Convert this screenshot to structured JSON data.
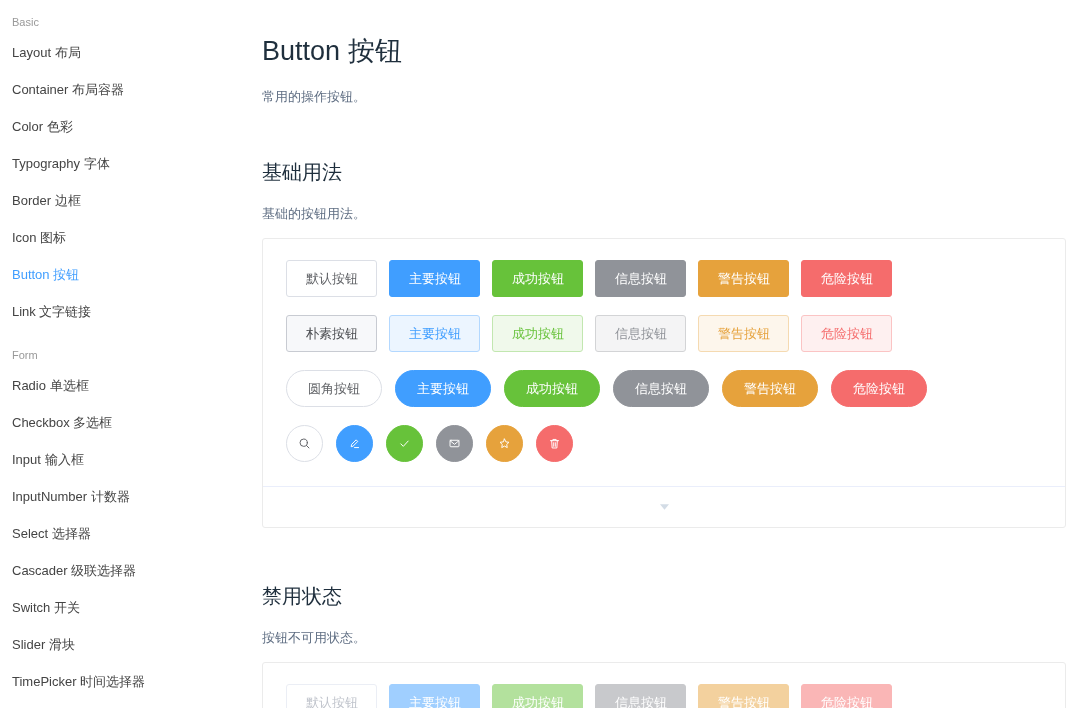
{
  "sidebar": {
    "groups": [
      {
        "title": "Basic",
        "items": [
          {
            "label": "Layout 布局",
            "selected": false
          },
          {
            "label": "Container 布局容器",
            "selected": false
          },
          {
            "label": "Color 色彩",
            "selected": false
          },
          {
            "label": "Typography 字体",
            "selected": false
          },
          {
            "label": "Border 边框",
            "selected": false
          },
          {
            "label": "Icon 图标",
            "selected": false
          },
          {
            "label": "Button 按钮",
            "selected": true
          },
          {
            "label": "Link 文字链接",
            "selected": false
          }
        ]
      },
      {
        "title": "Form",
        "items": [
          {
            "label": "Radio 单选框",
            "selected": false
          },
          {
            "label": "Checkbox 多选框",
            "selected": false
          },
          {
            "label": "Input 输入框",
            "selected": false
          },
          {
            "label": "InputNumber 计数器",
            "selected": false
          },
          {
            "label": "Select 选择器",
            "selected": false
          },
          {
            "label": "Cascader 级联选择器",
            "selected": false
          },
          {
            "label": "Switch 开关",
            "selected": false
          },
          {
            "label": "Slider 滑块",
            "selected": false
          },
          {
            "label": "TimePicker 时间选择器",
            "selected": false
          }
        ]
      }
    ]
  },
  "page": {
    "title": "Button 按钮",
    "description": "常用的操作按钮。"
  },
  "sections": [
    {
      "title": "基础用法",
      "description": "基础的按钮用法。",
      "expander": true,
      "rows": [
        {
          "kind": "square",
          "buttons": [
            {
              "kind": "default",
              "plain": false,
              "disabled": false,
              "label": "默认按钮"
            },
            {
              "kind": "primary",
              "plain": false,
              "disabled": false,
              "label": "主要按钮"
            },
            {
              "kind": "success",
              "plain": false,
              "disabled": false,
              "label": "成功按钮"
            },
            {
              "kind": "info",
              "plain": false,
              "disabled": false,
              "label": "信息按钮"
            },
            {
              "kind": "warning",
              "plain": false,
              "disabled": false,
              "label": "警告按钮"
            },
            {
              "kind": "danger",
              "plain": false,
              "disabled": false,
              "label": "危险按钮"
            }
          ]
        },
        {
          "kind": "square",
          "buttons": [
            {
              "kind": "default",
              "plain": true,
              "disabled": false,
              "label": "朴素按钮"
            },
            {
              "kind": "primary",
              "plain": true,
              "disabled": false,
              "label": "主要按钮"
            },
            {
              "kind": "success",
              "plain": true,
              "disabled": false,
              "label": "成功按钮"
            },
            {
              "kind": "info",
              "plain": true,
              "disabled": false,
              "label": "信息按钮"
            },
            {
              "kind": "warning",
              "plain": true,
              "disabled": false,
              "label": "警告按钮"
            },
            {
              "kind": "danger",
              "plain": true,
              "disabled": false,
              "label": "危险按钮"
            }
          ]
        },
        {
          "kind": "round",
          "buttons": [
            {
              "kind": "default",
              "plain": false,
              "disabled": false,
              "label": "圆角按钮"
            },
            {
              "kind": "primary",
              "plain": false,
              "disabled": false,
              "label": "主要按钮"
            },
            {
              "kind": "success",
              "plain": false,
              "disabled": false,
              "label": "成功按钮"
            },
            {
              "kind": "info",
              "plain": false,
              "disabled": false,
              "label": "信息按钮"
            },
            {
              "kind": "warning",
              "plain": false,
              "disabled": false,
              "label": "警告按钮"
            },
            {
              "kind": "danger",
              "plain": false,
              "disabled": false,
              "label": "危险按钮"
            }
          ]
        },
        {
          "kind": "circle",
          "buttons": [
            {
              "kind": "default",
              "plain": false,
              "disabled": false
            },
            {
              "kind": "primary",
              "plain": false,
              "disabled": false
            },
            {
              "kind": "success",
              "plain": false,
              "disabled": false
            },
            {
              "kind": "info",
              "plain": false,
              "disabled": false
            },
            {
              "kind": "warning",
              "plain": false,
              "disabled": false
            },
            {
              "kind": "danger",
              "plain": false,
              "disabled": false
            }
          ]
        }
      ]
    },
    {
      "title": "禁用状态",
      "description": "按钮不可用状态。",
      "expander": false,
      "rows": [
        {
          "kind": "square",
          "buttons": [
            {
              "kind": "default",
              "plain": false,
              "disabled": true,
              "label": "默认按钮"
            },
            {
              "kind": "primary",
              "plain": false,
              "disabled": true,
              "label": "主要按钮"
            },
            {
              "kind": "success",
              "plain": false,
              "disabled": true,
              "label": "成功按钮"
            },
            {
              "kind": "info",
              "plain": false,
              "disabled": true,
              "label": "信息按钮"
            },
            {
              "kind": "warning",
              "plain": false,
              "disabled": true,
              "label": "警告按钮"
            },
            {
              "kind": "danger",
              "plain": false,
              "disabled": true,
              "label": "危险按钮"
            }
          ]
        }
      ]
    }
  ]
}
